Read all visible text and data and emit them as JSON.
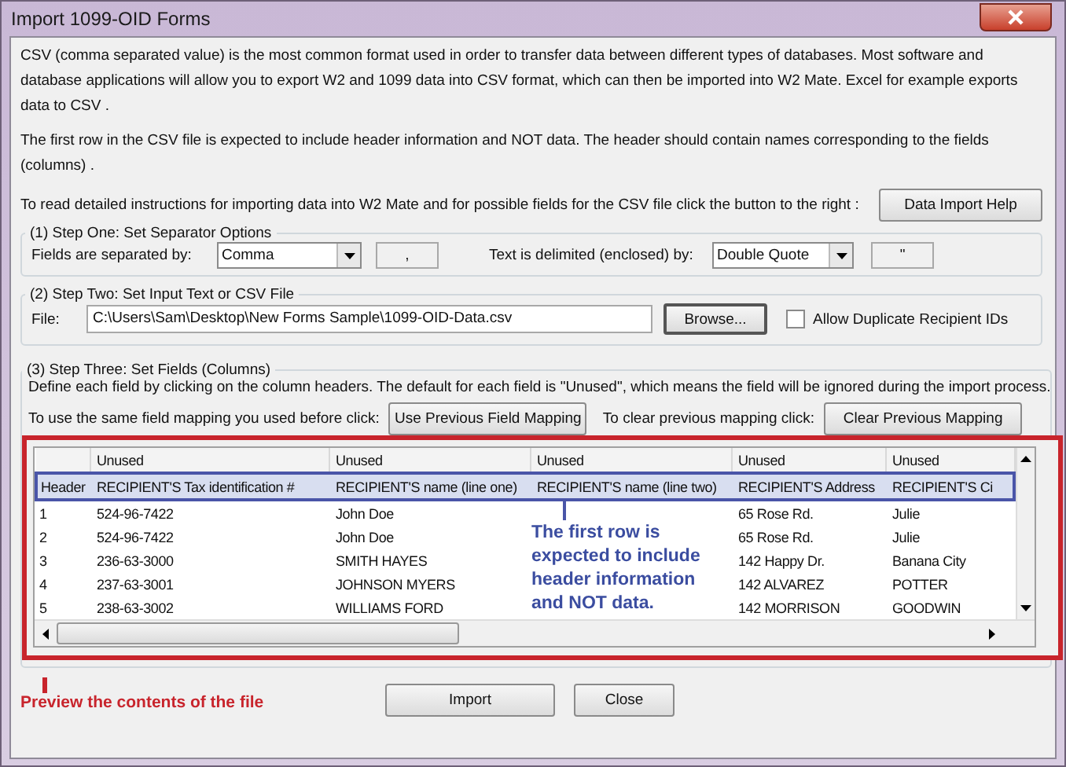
{
  "window": {
    "title": "Import 1099-OID Forms"
  },
  "intro": [
    "CSV (comma separated value) is the most common format used in order to transfer data between different types of databases.  Most software and database applications will allow you to export W2 and 1099 data into CSV format, which can then be imported into W2 Mate. Excel for example exports data to CSV .",
    "The first row in the CSV file is expected to include header information and NOT data. The header should contain names corresponding to the fields (columns) ."
  ],
  "help": {
    "prompt": "To read detailed instructions for importing data into W2 Mate and for possible fields for the CSV file click the button to the right :",
    "button": "Data Import Help"
  },
  "step_one": {
    "legend": "(1)  Step One: Set Separator Options",
    "fields_label": "Fields are separated by:",
    "fields_select": "Comma",
    "fields_char": ",",
    "text_label": "Text is delimited (enclosed) by:",
    "text_select": "Double Quote",
    "text_char": "\""
  },
  "step_two": {
    "legend": "(2)  Step Two: Set Input Text or CSV File",
    "file_label": "File:",
    "file_value": "C:\\Users\\Sam\\Desktop\\New Forms Sample\\1099-OID-Data.csv",
    "browse_button": "Browse...",
    "allow_duplicates": {
      "label": "Allow Duplicate Recipient IDs",
      "checked": false
    }
  },
  "step_three": {
    "legend": "(3)  Step Three: Set Fields (Columns)",
    "description": "Define each field by clicking on the column headers. The default for each field is \"Unused\", which means the field will be ignored during the import process.",
    "use_label": "To use the same field mapping you used before click:",
    "use_button": "Use Previous Field Mapping",
    "clear_label": "To clear previous mapping click:",
    "clear_button": "Clear Previous Mapping"
  },
  "grid": {
    "columns": [
      "Unused",
      "Unused",
      "Unused",
      "Unused",
      "Unused"
    ],
    "rows": [
      {
        "label": "Header",
        "selected": true,
        "cells": [
          "RECIPIENT'S Tax identification #",
          "RECIPIENT'S name (line one)",
          "RECIPIENT'S name (line two)",
          "RECIPIENT'S Address",
          "RECIPIENT'S Ci"
        ]
      },
      {
        "label": "1",
        "selected": false,
        "cells": [
          "524-96-7422",
          "John Doe",
          "",
          "65 Rose Rd.",
          "Julie"
        ]
      },
      {
        "label": "2",
        "selected": false,
        "cells": [
          "524-96-7422",
          "John Doe",
          "",
          "65 Rose Rd.",
          "Julie"
        ]
      },
      {
        "label": "3",
        "selected": false,
        "cells": [
          "236-63-3000",
          "SMITH HAYES",
          "",
          "142 Happy Dr.",
          "Banana City"
        ]
      },
      {
        "label": "4",
        "selected": false,
        "cells": [
          "237-63-3001",
          "JOHNSON MYERS",
          "",
          "142 ALVAREZ",
          "POTTER"
        ]
      },
      {
        "label": "5",
        "selected": false,
        "cells": [
          "238-63-3002",
          "WILLIAMS FORD",
          "",
          "142 MORRISON",
          "GOODWIN"
        ]
      }
    ]
  },
  "annotations": {
    "grid_note": "The first row is expected to include header information and NOT data.",
    "preview_note": "Preview the contents of the file"
  },
  "buttons": [
    "Import",
    "Close"
  ]
}
